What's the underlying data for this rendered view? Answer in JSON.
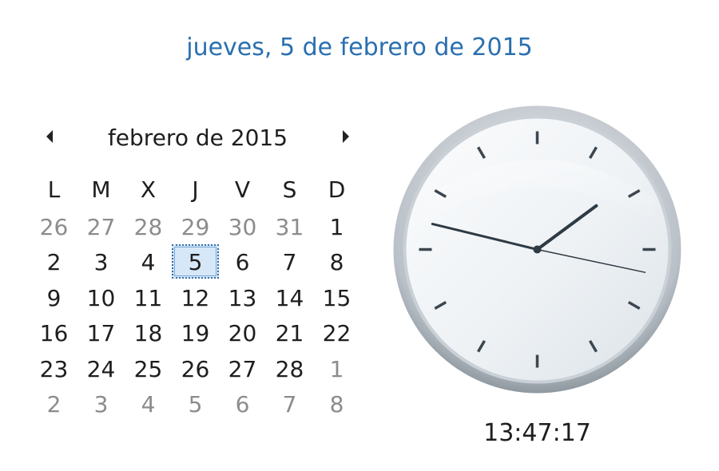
{
  "header": {
    "long_date": "jueves, 5 de febrero de 2015"
  },
  "calendar": {
    "month_title": "febrero de 2015",
    "prev_icon": "triangle-left-icon",
    "next_icon": "triangle-right-icon",
    "weekdays": [
      "L",
      "M",
      "X",
      "J",
      "V",
      "S",
      "D"
    ],
    "days": [
      {
        "label": "26",
        "muted": true
      },
      {
        "label": "27",
        "muted": true
      },
      {
        "label": "28",
        "muted": true
      },
      {
        "label": "29",
        "muted": true
      },
      {
        "label": "30",
        "muted": true
      },
      {
        "label": "31",
        "muted": true
      },
      {
        "label": "1",
        "muted": false
      },
      {
        "label": "2",
        "muted": false
      },
      {
        "label": "3",
        "muted": false
      },
      {
        "label": "4",
        "muted": false
      },
      {
        "label": "5",
        "muted": false,
        "selected": true
      },
      {
        "label": "6",
        "muted": false
      },
      {
        "label": "7",
        "muted": false
      },
      {
        "label": "8",
        "muted": false
      },
      {
        "label": "9",
        "muted": false
      },
      {
        "label": "10",
        "muted": false
      },
      {
        "label": "11",
        "muted": false
      },
      {
        "label": "12",
        "muted": false
      },
      {
        "label": "13",
        "muted": false
      },
      {
        "label": "14",
        "muted": false
      },
      {
        "label": "15",
        "muted": false
      },
      {
        "label": "16",
        "muted": false
      },
      {
        "label": "17",
        "muted": false
      },
      {
        "label": "18",
        "muted": false
      },
      {
        "label": "19",
        "muted": false
      },
      {
        "label": "20",
        "muted": false
      },
      {
        "label": "21",
        "muted": false
      },
      {
        "label": "22",
        "muted": false
      },
      {
        "label": "23",
        "muted": false
      },
      {
        "label": "24",
        "muted": false
      },
      {
        "label": "25",
        "muted": false
      },
      {
        "label": "26",
        "muted": false
      },
      {
        "label": "27",
        "muted": false
      },
      {
        "label": "28",
        "muted": false
      },
      {
        "label": "1",
        "muted": true
      },
      {
        "label": "2",
        "muted": true
      },
      {
        "label": "3",
        "muted": true
      },
      {
        "label": "4",
        "muted": true
      },
      {
        "label": "5",
        "muted": true
      },
      {
        "label": "6",
        "muted": true
      },
      {
        "label": "7",
        "muted": true
      },
      {
        "label": "8",
        "muted": true
      }
    ]
  },
  "clock": {
    "time": "13:47:17",
    "hours": 13,
    "minutes": 47,
    "seconds": 17,
    "icon": "analog-clock-icon"
  },
  "colors": {
    "date_link": "#2a6fb0",
    "selected_day_bg": "#d6e8f8",
    "muted_text": "#8c8c8c"
  }
}
